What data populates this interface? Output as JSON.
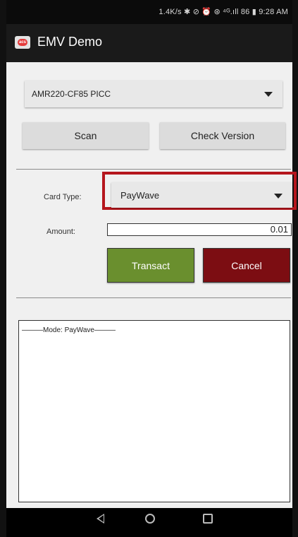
{
  "status_bar": {
    "text": "1.4K/s ✱ ⊘ ⏰ ⊛ ⁴ᴳ.ıll 86 ▮ 9:28 AM"
  },
  "app_bar": {
    "title": "EMV Demo",
    "logo_text": "acs"
  },
  "reader": {
    "selected": "AMR220-CF85 PICC"
  },
  "buttons": {
    "scan": "Scan",
    "check_version": "Check Version",
    "transact": "Transact",
    "cancel": "Cancel"
  },
  "form": {
    "card_type_label": "Card Type:",
    "card_type_value": "PayWave",
    "amount_label": "Amount:",
    "amount_value": "0.01"
  },
  "log": {
    "text": "———Mode: PayWave———"
  },
  "colors": {
    "transact": "#6a8f2e",
    "cancel": "#7c0d12",
    "highlight": "#b5161d"
  },
  "nav": {
    "back_icon": "back-icon",
    "home_icon": "home-icon",
    "recent_icon": "recent-apps-icon"
  }
}
